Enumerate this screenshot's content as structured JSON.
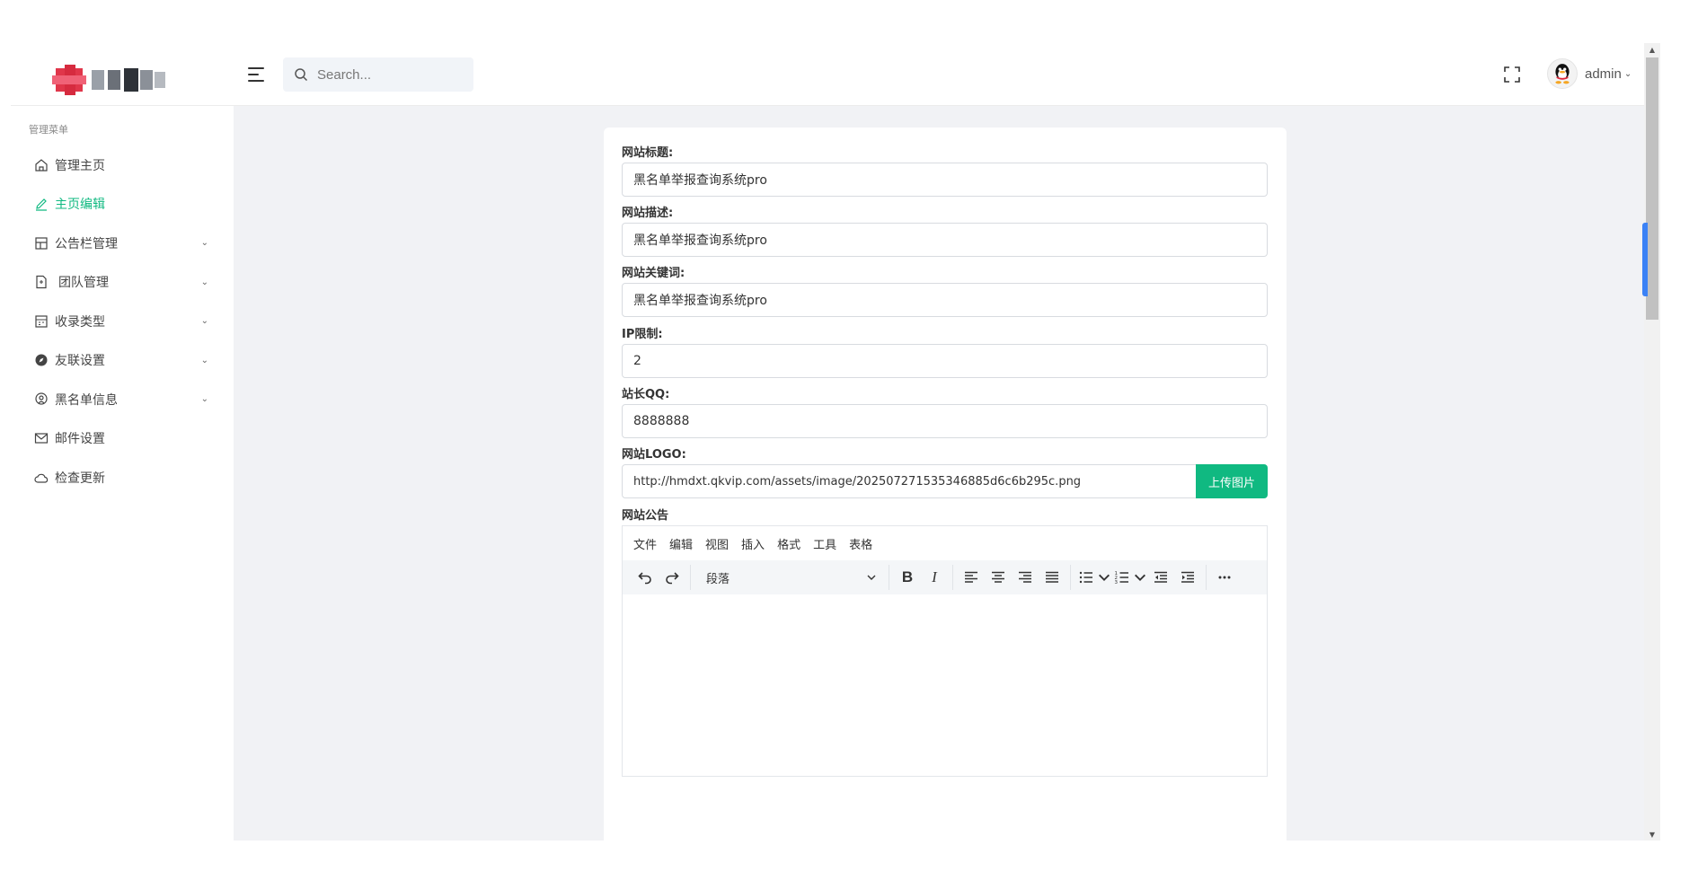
{
  "header": {
    "search_placeholder": "Search...",
    "user_name": "admin"
  },
  "sidebar": {
    "title": "管理菜单",
    "items": [
      {
        "label": "管理主页",
        "icon": "home-icon",
        "has_arrow": false,
        "active": false
      },
      {
        "label": "主页编辑",
        "icon": "edit-icon",
        "has_arrow": false,
        "active": true
      },
      {
        "label": "公告栏管理",
        "icon": "layout-icon",
        "has_arrow": true,
        "active": false
      },
      {
        "label": "团队管理",
        "icon": "document-icon",
        "has_arrow": true,
        "active": false
      },
      {
        "label": "收录类型",
        "icon": "calendar-icon",
        "has_arrow": true,
        "active": false
      },
      {
        "label": "友联设置",
        "icon": "compass-icon",
        "has_arrow": true,
        "active": false
      },
      {
        "label": "黑名单信息",
        "icon": "map-pin-icon",
        "has_arrow": true,
        "active": false
      },
      {
        "label": "邮件设置",
        "icon": "mail-icon",
        "has_arrow": false,
        "active": false
      },
      {
        "label": "检查更新",
        "icon": "cloud-icon",
        "has_arrow": false,
        "active": false
      }
    ]
  },
  "form": {
    "title_label": "网站标题:",
    "title_value": "黑名单举报查询系统pro",
    "desc_label": "网站描述:",
    "desc_value": "黑名单举报查询系统pro",
    "keywords_label": "网站关键词:",
    "keywords_value": "黑名单举报查询系统pro",
    "ip_label": "IP限制:",
    "ip_value": "2",
    "qq_label": "站长QQ:",
    "qq_value": "8888888",
    "logo_label": "网站LOGO:",
    "logo_value": "http://hmdxt.qkvip.com/assets/image/20250727153534688​5d6c6b295c.png",
    "upload_label": "上传图片",
    "notice_label": "网站公告"
  },
  "editor": {
    "menus": [
      "文件",
      "编辑",
      "视图",
      "插入",
      "格式",
      "工具",
      "表格"
    ],
    "block_format": "段落"
  },
  "colors": {
    "accent": "#10b981",
    "main_bg": "#f1f2f5"
  }
}
